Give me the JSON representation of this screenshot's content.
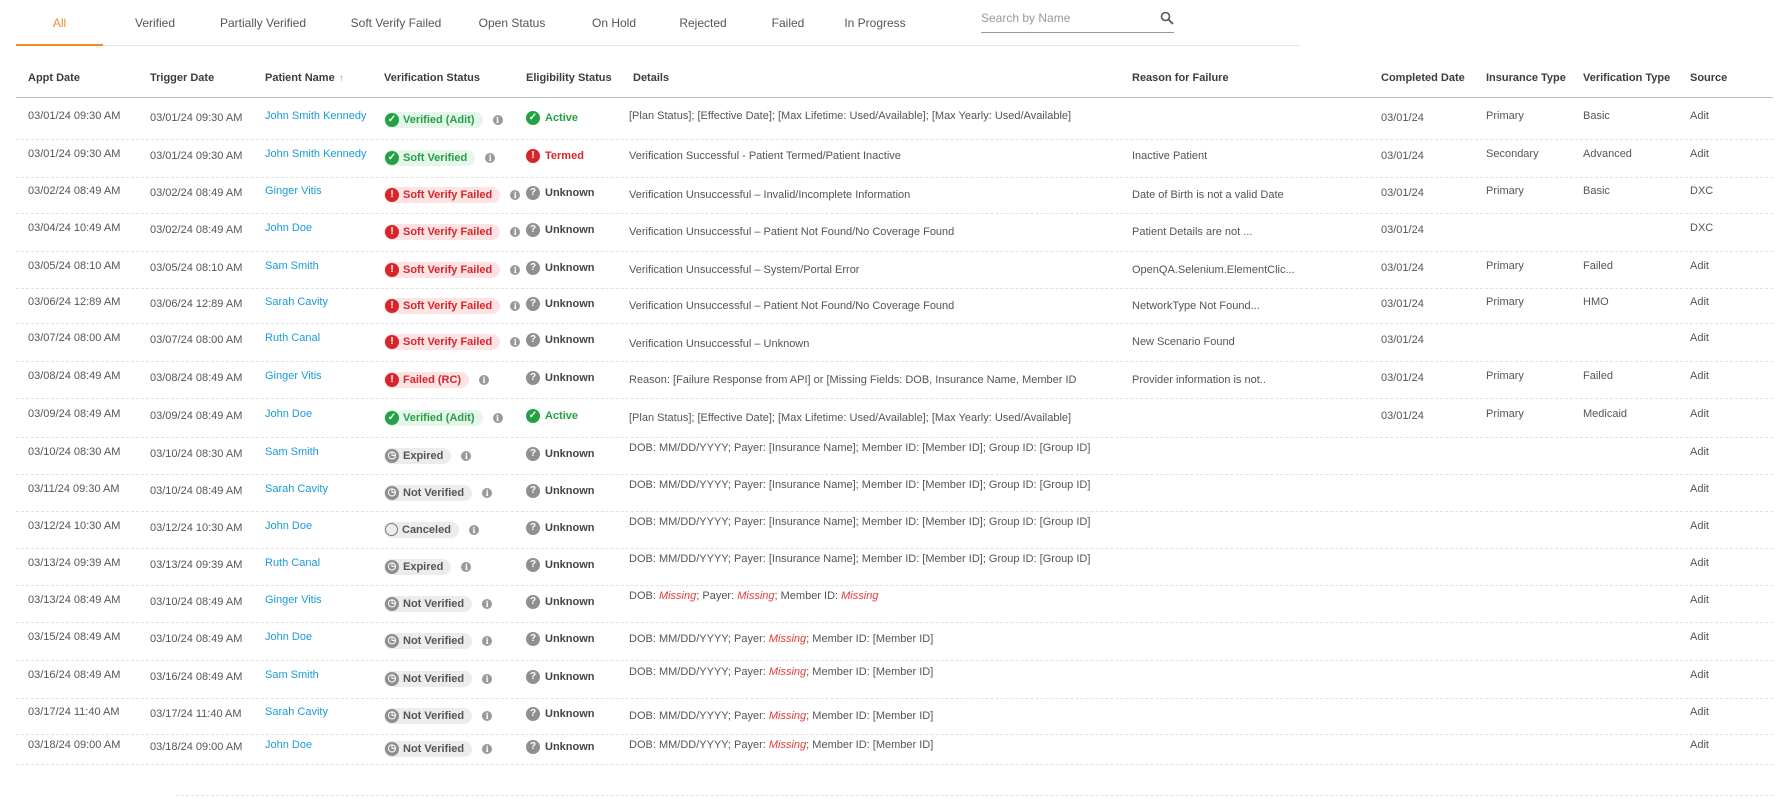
{
  "tabs": [
    {
      "label": "All",
      "active": true
    },
    {
      "label": "Verified"
    },
    {
      "label": "Partially Verified"
    },
    {
      "label": "Soft Verify Failed"
    },
    {
      "label": "Open Status"
    },
    {
      "label": "On Hold"
    },
    {
      "label": "Rejected"
    },
    {
      "label": "Failed"
    },
    {
      "label": "In Progress"
    }
  ],
  "search": {
    "placeholder": "Search by Name",
    "icon": "search-icon"
  },
  "colors": {
    "accent": "#f28a2e",
    "link": "#1a9bd7",
    "success": "#23a144",
    "danger": "#d6262b",
    "neutral": "#8f8f8f"
  },
  "columns": {
    "appt_date": "Appt Date",
    "trigger_date": "Trigger Date",
    "patient_name": "Patient Name",
    "sort_indicator": "↑",
    "verification_status": "Verification Status",
    "eligibility_status": "Eligibility Status",
    "details": "Details",
    "reason": "Reason for Failure",
    "completed_date": "Completed Date",
    "insurance_type": "Insurance Type",
    "verification_type": "Verification Type",
    "source": "Source"
  },
  "rows": [
    {
      "appt": "03/01/24 09:30 AM",
      "trigger": "03/01/24 09:30 AM",
      "patient": "John Smith Kennedy",
      "vstatus": "Verified (Adit)",
      "vkind": "green",
      "elig": "Active",
      "ekind": "active",
      "details": [
        {
          "t": "[Plan Status]; [Effective Date]; [Max Lifetime: Used/Available]; [Max Yearly: Used/Available]"
        }
      ],
      "reason": "",
      "completed": "03/01/24",
      "insurance": "Primary",
      "vtype": "Basic",
      "source": "Adit"
    },
    {
      "appt": "03/01/24 09:30 AM",
      "trigger": "03/01/24 09:30 AM",
      "patient": "John Smith Kennedy",
      "vstatus": "Soft Verified",
      "vkind": "green",
      "elig": "Termed",
      "ekind": "termed",
      "details": [
        {
          "t": "Verification Successful - Patient Termed/Patient Inactive"
        }
      ],
      "reason": "Inactive Patient",
      "completed": "03/01/24",
      "insurance": "Secondary",
      "vtype": "Advanced",
      "source": "Adit"
    },
    {
      "appt": "03/02/24 08:49 AM",
      "trigger": "03/02/24 08:49 AM",
      "patient": "Ginger Vitis",
      "vstatus": "Soft Verify Failed",
      "vkind": "red",
      "elig": "Unknown",
      "ekind": "unknown",
      "details": [
        {
          "t": "Verification Unsuccessful – Invalid/Incomplete Information"
        }
      ],
      "reason": "Date of Birth is not a valid Date",
      "completed": "03/01/24",
      "insurance": "Primary",
      "vtype": "Basic",
      "source": "DXC"
    },
    {
      "appt": "03/04/24 10:49 AM",
      "trigger": "03/02/24 08:49 AM",
      "patient": "John Doe",
      "vstatus": "Soft Verify Failed",
      "vkind": "red",
      "elig": "Unknown",
      "ekind": "unknown",
      "details": [
        {
          "t": "Verification Unsuccessful – Patient Not Found/No Coverage Found"
        }
      ],
      "reason": "Patient Details are not ...",
      "completed": "03/01/24",
      "insurance": "",
      "vtype": "",
      "source": "DXC"
    },
    {
      "appt": "03/05/24 08:10 AM",
      "trigger": "03/05/24 08:10 AM",
      "patient": "Sam Smith",
      "vstatus": "Soft Verify Failed",
      "vkind": "red",
      "elig": "Unknown",
      "ekind": "unknown",
      "details": [
        {
          "t": "Verification Unsuccessful – System/Portal Error"
        }
      ],
      "reason": "OpenQA.Selenium.ElementClic...",
      "completed": "03/01/24",
      "insurance": "Primary",
      "vtype": "Failed",
      "source": "Adit"
    },
    {
      "appt": "03/06/24 12:89 AM",
      "trigger": "03/06/24 12:89 AM",
      "patient": "Sarah Cavity",
      "vstatus": "Soft Verify Failed",
      "vkind": "red",
      "elig": "Unknown",
      "ekind": "unknown",
      "details": [
        {
          "t": "Verification Unsuccessful – Patient Not Found/No Coverage Found"
        }
      ],
      "reason": "NetworkType  Not Found...",
      "completed": "03/01/24",
      "insurance": "Primary",
      "vtype": "HMO",
      "source": "Adit"
    },
    {
      "appt": "03/07/24 08:00 AM",
      "trigger": "03/07/24 08:00 AM",
      "patient": "Ruth Canal",
      "vstatus": "Soft Verify Failed",
      "vkind": "red",
      "elig": "Unknown",
      "ekind": "unknown",
      "details": [
        {
          "t": "Verification Unsuccessful – Unknown"
        }
      ],
      "reason": "New Scenario Found",
      "completed": "03/01/24",
      "insurance": "",
      "vtype": "",
      "source": "Adit"
    },
    {
      "appt": "03/08/24 08:49 AM",
      "trigger": "03/08/24 08:49 AM",
      "patient": "Ginger Vitis",
      "vstatus": "Failed (RC)",
      "vkind": "red",
      "elig": "Unknown",
      "ekind": "unknown",
      "details": [
        {
          "t": "Reason: [Failure Response from API] or [Missing Fields: DOB, Insurance Name, Member ID"
        }
      ],
      "reason": "Provider information is not..",
      "completed": "03/01/24",
      "insurance": "Primary",
      "vtype": "Failed",
      "source": "Adit"
    },
    {
      "appt": "03/09/24 08:49 AM",
      "trigger": "03/09/24 08:49 AM",
      "patient": "John Doe",
      "vstatus": "Verified (Adit)",
      "vkind": "green",
      "elig": "Active",
      "ekind": "active",
      "details": [
        {
          "t": "[Plan Status]; [Effective Date]; [Max Lifetime: Used/Available]; [Max Yearly: Used/Available]"
        }
      ],
      "reason": "",
      "completed": "03/01/24",
      "insurance": "Primary",
      "vtype": "Medicaid",
      "source": "Adit"
    },
    {
      "appt": "03/10/24 08:30 AM",
      "trigger": "03/10/24 08:30 AM",
      "patient": "Sam Smith",
      "vstatus": "Expired",
      "vkind": "gray",
      "elig": "Unknown",
      "ekind": "unknown",
      "details": [
        {
          "t": "DOB: MM/DD/YYYY; Payer: [Insurance Name]; Member ID: [Member ID]; Group ID: [Group ID]"
        }
      ],
      "reason": "",
      "completed": "",
      "insurance": "",
      "vtype": "",
      "source": "Adit"
    },
    {
      "appt": "03/11/24 09:30 AM",
      "trigger": "03/10/24 08:49 AM",
      "patient": "Sarah Cavity",
      "vstatus": "Not Verified",
      "vkind": "gray",
      "elig": "Unknown",
      "ekind": "unknown",
      "details": [
        {
          "t": "DOB: MM/DD/YYYY; Payer: [Insurance Name]; Member ID: [Member ID]; Group ID: [Group ID]"
        }
      ],
      "reason": "",
      "completed": "",
      "insurance": "",
      "vtype": "",
      "source": "Adit"
    },
    {
      "appt": "03/12/24 10:30 AM",
      "trigger": "03/12/24 10:30 AM",
      "patient": "John Doe",
      "vstatus": "Canceled",
      "vkind": "cancel",
      "elig": "Unknown",
      "ekind": "unknown",
      "details": [
        {
          "t": "DOB: MM/DD/YYYY; Payer: [Insurance Name]; Member ID: [Member ID]; Group ID: [Group ID]"
        }
      ],
      "reason": "",
      "completed": "",
      "insurance": "",
      "vtype": "",
      "source": "Adit"
    },
    {
      "appt": "03/13/24 09:39 AM",
      "trigger": "03/13/24 09:39 AM",
      "patient": "Ruth Canal",
      "vstatus": "Expired",
      "vkind": "gray",
      "elig": "Unknown",
      "ekind": "unknown",
      "details": [
        {
          "t": "DOB: MM/DD/YYYY; Payer: [Insurance Name]; Member ID: [Member ID]; Group ID: [Group ID]"
        }
      ],
      "reason": "",
      "completed": "",
      "insurance": "",
      "vtype": "",
      "source": "Adit"
    },
    {
      "appt": "03/13/24 08:49 AM",
      "trigger": "03/10/24 08:49 AM",
      "patient": "Ginger Vitis",
      "vstatus": "Not Verified",
      "vkind": "gray",
      "elig": "Unknown",
      "ekind": "unknown",
      "details": [
        {
          "t": "DOB: "
        },
        {
          "t": "Missing",
          "m": true
        },
        {
          "t": "; Payer: "
        },
        {
          "t": "Missing",
          "m": true
        },
        {
          "t": "; Member ID: "
        },
        {
          "t": "Missing",
          "m": true
        }
      ],
      "reason": "",
      "completed": "",
      "insurance": "",
      "vtype": "",
      "source": "Adit"
    },
    {
      "appt": "03/15/24 08:49 AM",
      "trigger": "03/10/24 08:49 AM",
      "patient": "John Doe",
      "vstatus": "Not Verified",
      "vkind": "gray",
      "elig": "Unknown",
      "ekind": "unknown",
      "details": [
        {
          "t": "DOB: MM/DD/YYYY; Payer: "
        },
        {
          "t": "Missing",
          "m": true
        },
        {
          "t": "; Member ID: [Member ID]"
        }
      ],
      "reason": "",
      "completed": "",
      "insurance": "",
      "vtype": "",
      "source": "Adit"
    },
    {
      "appt": "03/16/24 08:49 AM",
      "trigger": "03/16/24 08:49 AM",
      "patient": "Sam Smith",
      "vstatus": "Not Verified",
      "vkind": "gray",
      "elig": "Unknown",
      "ekind": "unknown",
      "details": [
        {
          "t": "DOB: MM/DD/YYYY; Payer: "
        },
        {
          "t": "Missing",
          "m": true
        },
        {
          "t": "; Member ID: [Member ID]"
        }
      ],
      "reason": "",
      "completed": "",
      "insurance": "",
      "vtype": "",
      "source": "Adit"
    },
    {
      "appt": "03/17/24 11:40 AM",
      "trigger": "03/17/24 11:40 AM",
      "patient": "Sarah Cavity",
      "vstatus": "Not Verified",
      "vkind": "gray",
      "elig": "Unknown",
      "ekind": "unknown",
      "details": [
        {
          "t": "DOB: MM/DD/YYYY; Payer: "
        },
        {
          "t": "Missing",
          "m": true
        },
        {
          "t": "; Member ID: [Member ID]"
        }
      ],
      "reason": "",
      "completed": "",
      "insurance": "",
      "vtype": "",
      "source": "Adit"
    },
    {
      "appt": "03/18/24 09:00 AM",
      "trigger": "03/18/24 09:00 AM",
      "patient": "John Doe",
      "vstatus": "Not Verified",
      "vkind": "gray",
      "elig": "Unknown",
      "ekind": "unknown",
      "details": [
        {
          "t": "DOB: MM/DD/YYYY; Payer: "
        },
        {
          "t": "Missing",
          "m": true
        },
        {
          "t": "; Member ID: [Member ID]"
        }
      ],
      "reason": "",
      "completed": "",
      "insurance": "",
      "vtype": "",
      "source": "Adit"
    }
  ]
}
